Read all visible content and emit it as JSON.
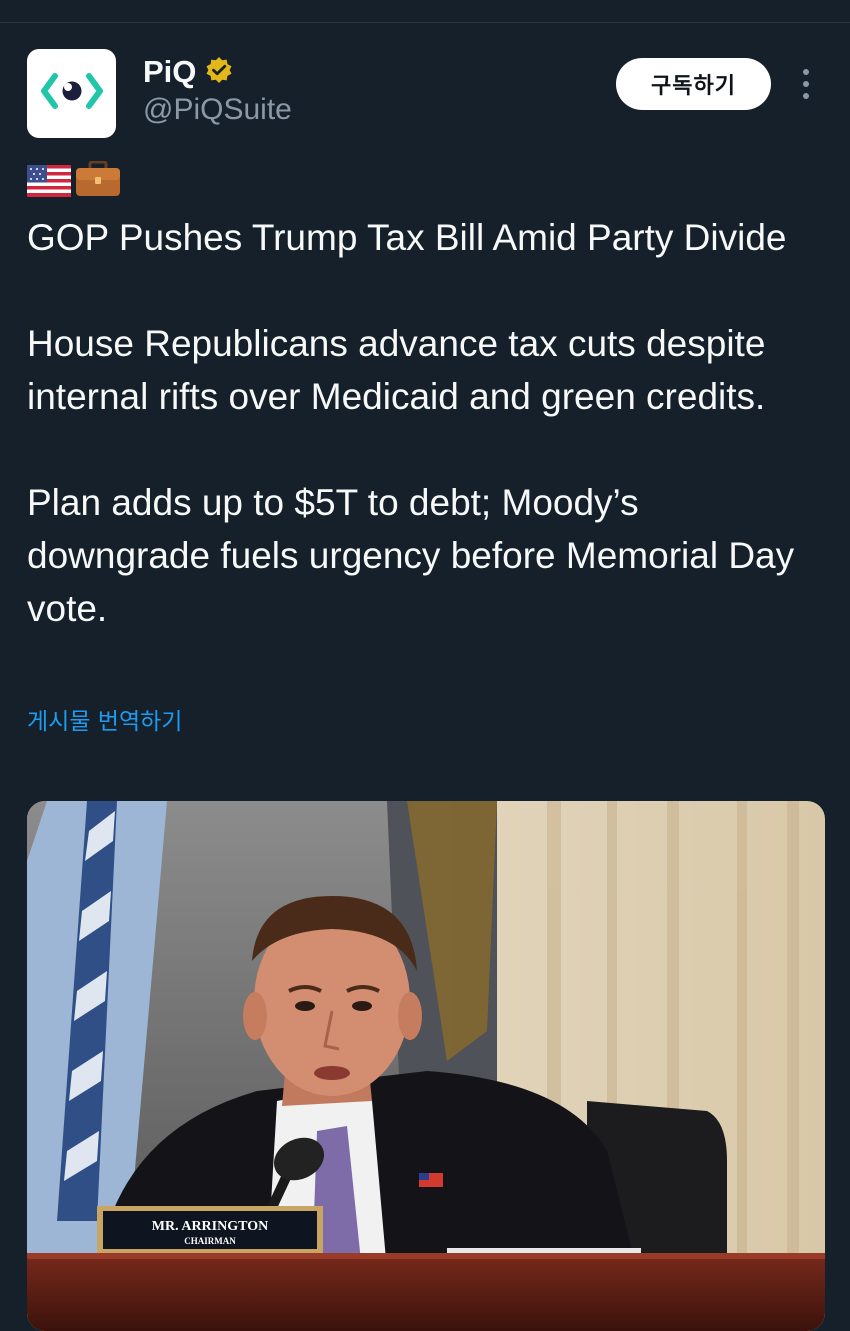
{
  "account": {
    "display_name": "PiQ",
    "handle": "@PiQSuite",
    "verified": true,
    "avatar_icon": "piq-logo-icon",
    "verified_icon": "verified-badge-icon"
  },
  "header": {
    "subscribe_label": "구독하기",
    "more_icon": "more-options-icon"
  },
  "post": {
    "emojis": [
      "us-flag-icon",
      "briefcase-icon"
    ],
    "title": "GOP Pushes Trump Tax Bill Amid Party Divide",
    "paragraph_1": "House Republicans advance tax cuts despite internal rifts over Medicaid and green credits.",
    "paragraph_2": "Plan adds up to $5T to debt; Moody’s downgrade fuels urgency before Memorial Day vote.",
    "translate_label": "게시물 번역하기"
  },
  "media": {
    "nameplate_name": "MR. ARRINGTON",
    "nameplate_title": "CHAIRMAN"
  },
  "colors": {
    "background": "#15202b",
    "text_primary": "#f7f9f9",
    "text_secondary": "#8b98a5",
    "link": "#1d9bf0",
    "verified_badge": "#e2b719",
    "logo_accent": "#1fc7a8"
  }
}
